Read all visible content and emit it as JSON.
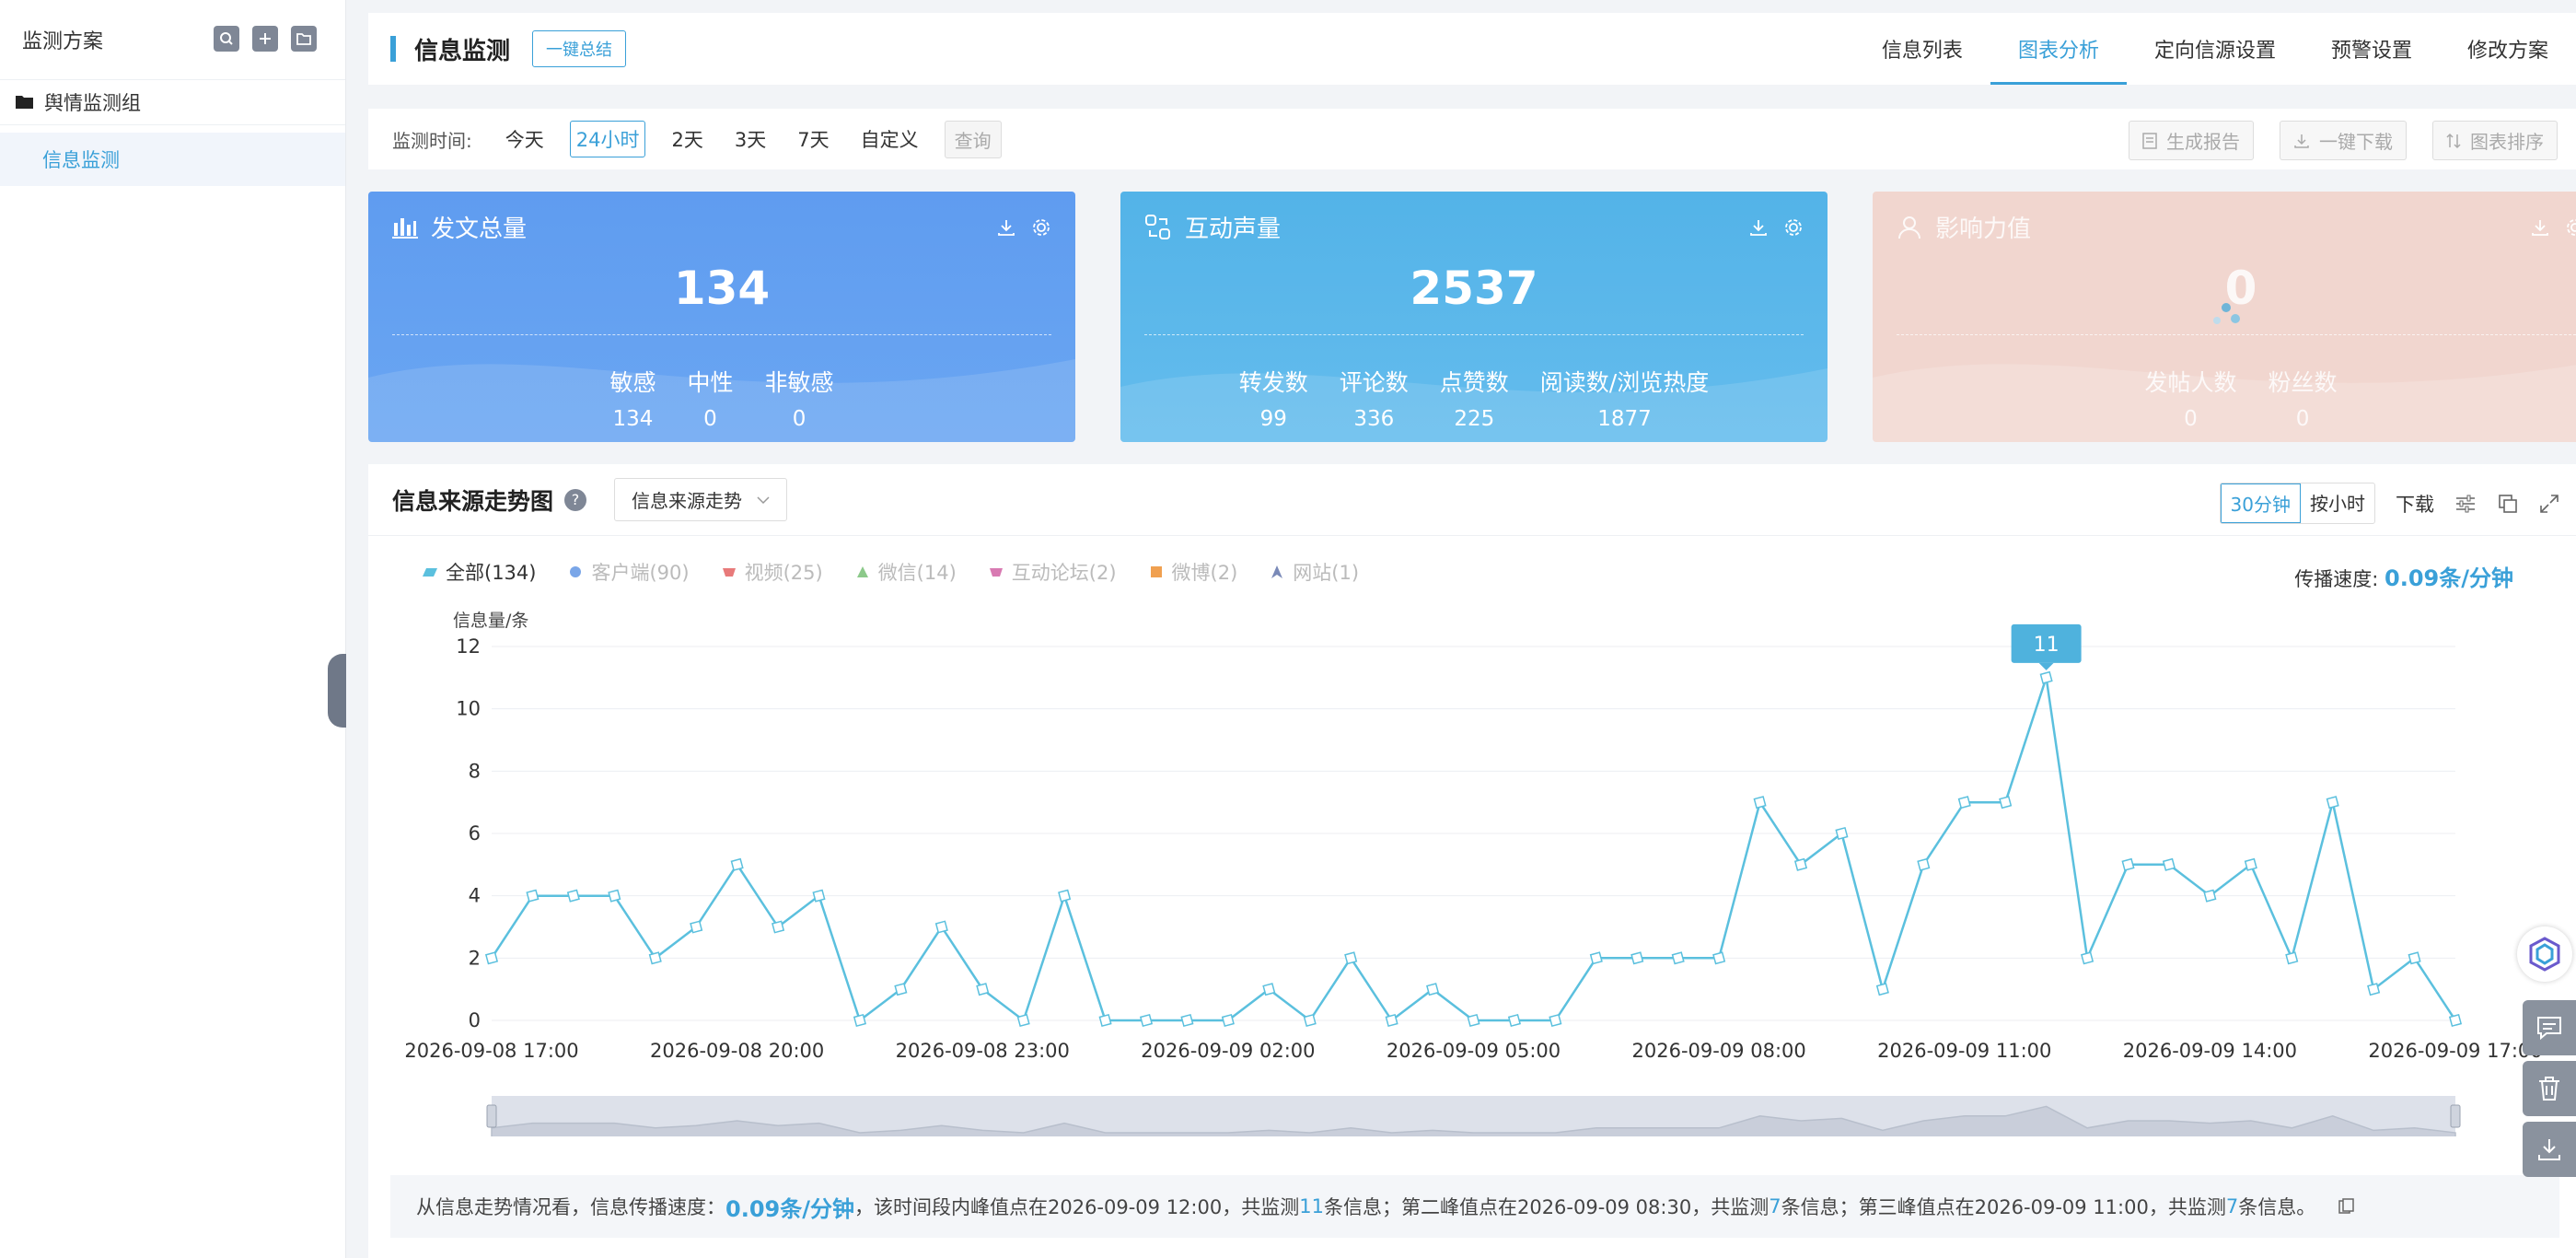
{
  "sidebar": {
    "title": "监测方案",
    "group": "舆情监测组",
    "item": "信息监测"
  },
  "header": {
    "title": "信息监测",
    "summary_btn": "一键总结",
    "tabs": [
      "信息列表",
      "图表分析",
      "定向信源设置",
      "预警设置",
      "修改方案"
    ],
    "active_tab": 1
  },
  "filter": {
    "label": "监测时间:",
    "options": [
      "今天",
      "24小时",
      "2天",
      "3天",
      "7天",
      "自定义"
    ],
    "active": 1,
    "query": "查询",
    "actions": [
      "生成报告",
      "一键下载",
      "图表排序"
    ]
  },
  "cards": {
    "posts": {
      "title": "发文总量",
      "total": "134",
      "stats": [
        {
          "label": "敏感",
          "value": "134"
        },
        {
          "label": "中性",
          "value": "0"
        },
        {
          "label": "非敏感",
          "value": "0"
        }
      ]
    },
    "interact": {
      "title": "互动声量",
      "total": "2537",
      "stats": [
        {
          "label": "转发数",
          "value": "99"
        },
        {
          "label": "评论数",
          "value": "336"
        },
        {
          "label": "点赞数",
          "value": "225"
        },
        {
          "label": "阅读数/浏览热度",
          "value": "1877"
        }
      ]
    },
    "influence": {
      "title": "影响力值",
      "total": "0",
      "stats": [
        {
          "label": "发帖人数",
          "value": "0"
        },
        {
          "label": "粉丝数",
          "value": "0"
        }
      ]
    }
  },
  "chart_panel": {
    "title": "信息来源走势图",
    "help": "?",
    "select": "信息来源走势",
    "granularity": [
      "30分钟",
      "按小时"
    ],
    "download": "下载",
    "speed_label": "传播速度:",
    "speed_value": "0.09条/分钟",
    "legend": [
      {
        "name": "全部(134)",
        "color": "#5bc0de",
        "on": true,
        "shape": "para"
      },
      {
        "name": "客户端(90)",
        "color": "#7aa6e8",
        "on": false,
        "shape": "circle"
      },
      {
        "name": "视频(25)",
        "color": "#e87a7a",
        "on": false,
        "shape": "trap"
      },
      {
        "name": "微信(14)",
        "color": "#8cc98a",
        "on": false,
        "shape": "tri"
      },
      {
        "name": "互动论坛(2)",
        "color": "#d87ab2",
        "on": false,
        "shape": "trap"
      },
      {
        "name": "微博(2)",
        "color": "#f0a050",
        "on": false,
        "shape": "square"
      },
      {
        "name": "网站(1)",
        "color": "#7a8ab8",
        "on": false,
        "shape": "arrow"
      }
    ],
    "summary": {
      "p1": "从信息走势情况看，信息传播速度：",
      "speed": "0.09条/分钟",
      "p2": "，该时间段内峰值点在2026-09-09 12:00，共监测",
      "n1": "11",
      "p3": "条信息；第二峰值点在2026-09-09 08:30，共监测",
      "n2": "7",
      "p4": "条信息；第三峰值点在2026-09-09 11:00，共监测",
      "n3": "7",
      "p5": "条信息。"
    }
  },
  "chart_data": {
    "type": "line",
    "ylabel": "信息量/条",
    "ylim": [
      0,
      12
    ],
    "yticks": [
      0,
      2,
      4,
      6,
      8,
      10,
      12
    ],
    "x_tick_labels": [
      "2026-09-08 17:00",
      "2026-09-08 20:00",
      "2026-09-08 23:00",
      "2026-09-09 02:00",
      "2026-09-09 05:00",
      "2026-09-09 08:00",
      "2026-09-09 11:00",
      "2026-09-09 14:00",
      "2026-09-09 17:00"
    ],
    "x_start": "2026-09-08 17:00",
    "x_step_minutes": 30,
    "series": [
      {
        "name": "全部(134)",
        "values": [
          2,
          4,
          4,
          4,
          2,
          3,
          5,
          3,
          4,
          0,
          1,
          3,
          1,
          0,
          4,
          0,
          0,
          0,
          0,
          1,
          0,
          2,
          0,
          1,
          0,
          0,
          0,
          2,
          2,
          2,
          2,
          7,
          5,
          6,
          1,
          5,
          7,
          7,
          11,
          2,
          5,
          5,
          4,
          5,
          2,
          7,
          1,
          2,
          0
        ]
      }
    ],
    "peak_label": "11",
    "color": "#5bc0de"
  }
}
